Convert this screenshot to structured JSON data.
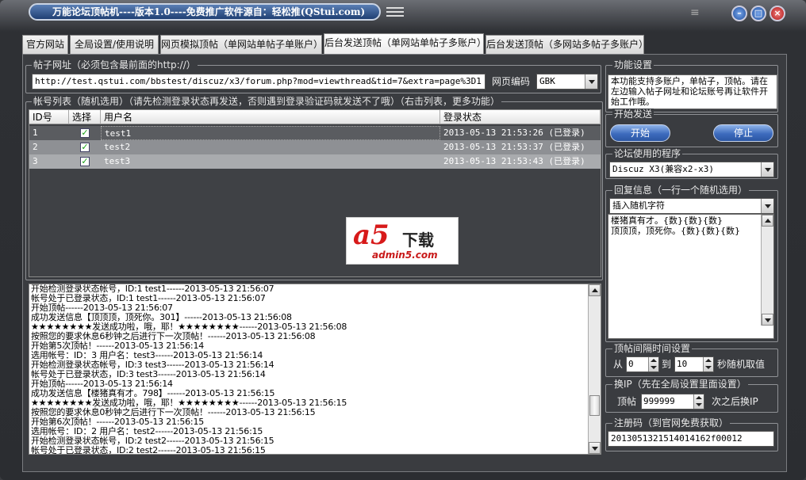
{
  "window": {
    "title": "万能论坛顶帖机----版本1.0----免费推广软件源自：轻松推(QStui.com)",
    "lines_glyph": "≡"
  },
  "tabs": [
    {
      "label": "官方网站"
    },
    {
      "label": "全局设置/使用说明"
    },
    {
      "label": "网页模拟顶帖（单网站单帖子单账户）"
    },
    {
      "label": "后台发送顶帖（单网站单帖子多账户）"
    },
    {
      "label": "后台发送顶帖（多网站多帖子多账户）"
    }
  ],
  "active_tab": 3,
  "post_url": {
    "label": "帖子网址（必须包含最前面的http://）",
    "value": "http://test.qstui.com/bbstest/discuz/x3/forum.php?mod=viewthread&tid=7&extra=page%3D1",
    "encoding_label": "网页编码",
    "encoding_value": "GBK"
  },
  "accounts": {
    "label": "帐号列表（随机选用）（请先检测登录状态再发送，否则遇到登录验证码就发送不了哦）（右击列表，更多功能）",
    "columns": [
      "ID号",
      "选择",
      "用户名",
      "登录状态"
    ],
    "rows": [
      {
        "id": "1",
        "checked": true,
        "user": "test1",
        "status": "2013-05-13 21:53:26 (已登录)"
      },
      {
        "id": "2",
        "checked": true,
        "user": "test2",
        "status": "2013-05-13 21:53:37 (已登录)"
      },
      {
        "id": "3",
        "checked": true,
        "user": "test3",
        "status": "2013-05-13 21:53:43 (已登录)"
      }
    ]
  },
  "watermark": {
    "a5": "a5",
    "xz": "下载",
    "domain": "admin5.com"
  },
  "log": [
    "开始检测登录状态帐号，ID:1 test1------2013-05-13 21:56:07",
    "帐号处于已登录状态，ID:1 test1------2013-05-13 21:56:07",
    "开始顶帖------2013-05-13 21:56:07",
    "成功发送信息【顶顶顶，顶死你。301】------2013-05-13 21:56:08",
    "★★★★★★★★发送成功啦，哦，耶！★★★★★★★★------2013-05-13 21:56:08",
    "按照您的要求休息6秒钟之后进行下一次顶帖！------2013-05-13 21:56:08",
    "开始第5次顶帖！------2013-05-13 21:56:14",
    "选用帐号：ID：3 用户名：test3------2013-05-13 21:56:14",
    "开始检测登录状态帐号，ID:3 test3------2013-05-13 21:56:14",
    "帐号处于已登录状态，ID:3 test3------2013-05-13 21:56:14",
    "开始顶帖------2013-05-13 21:56:14",
    "成功发送信息【楼猪真有才。798】------2013-05-13 21:56:15",
    "★★★★★★★★发送成功啦，哦，耶！★★★★★★★★------2013-05-13 21:56:15",
    "按照您的要求休息0秒钟之后进行下一次顶帖！------2013-05-13 21:56:15",
    "开始第6次顶帖！------2013-05-13 21:56:15",
    "选用帐号：ID：2 用户名：test2------2013-05-13 21:56:15",
    "开始检测登录状态帐号，ID:2 test2------2013-05-13 21:56:15",
    "帐号处于已登录状态，ID:2 test2------2013-05-13 21:56:15"
  ],
  "func": {
    "label": "功能设置",
    "desc": "本功能支持多账户，单帖子，顶帖。请在左边输入帖子网址和论坛账号再让软件开始工作哦。"
  },
  "send": {
    "label": "开始发送",
    "start": "开始",
    "stop": "停止"
  },
  "forum": {
    "label": "论坛使用的程序",
    "value": "Discuz X3(兼容x2-x3)"
  },
  "reply": {
    "label": "回复信息（一行一个随机选用）",
    "insert": "插入随机字符",
    "lines": [
      "楼猪真有才。{数}{数}{数}",
      "顶顶顶，顶死你。{数}{数}{数}"
    ]
  },
  "interval": {
    "label": "顶帖间隔时间设置",
    "from": "从",
    "from_value": "0",
    "to": "到",
    "to_value": "10",
    "suffix": "秒随机取值"
  },
  "ip": {
    "label": "换IP（先在全局设置里面设置）",
    "prefix": "顶帖",
    "value": "999999",
    "suffix": "次之后换IP"
  },
  "reg": {
    "label": "注册码（到官网免费获取）",
    "value": "2013051321514014162f00012"
  }
}
